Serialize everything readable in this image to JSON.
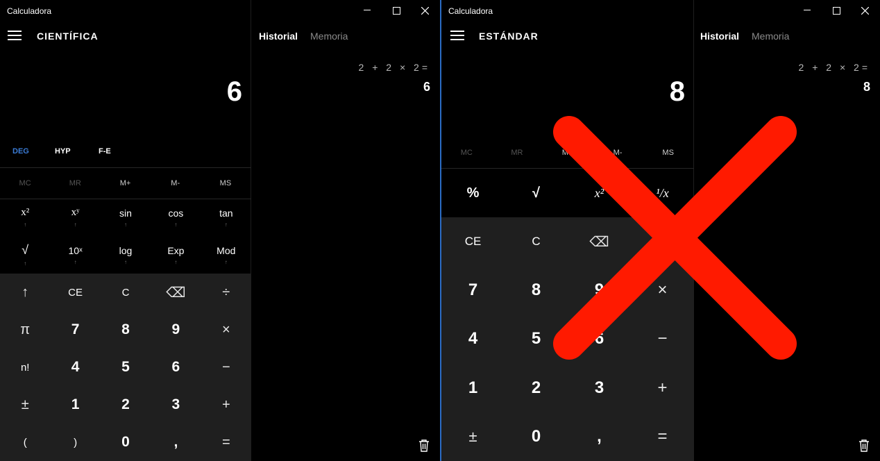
{
  "left": {
    "app_title": "Calculadora",
    "mode": "CIENTÍFICA",
    "display": "6",
    "tabs": [
      "Historial",
      "Memoria"
    ],
    "history_expr": "2 + 2 × 2=",
    "history_result": "6",
    "angle_modes": {
      "deg": "DEG",
      "hyp": "HYP",
      "fe": "F-E"
    },
    "memory": [
      "MC",
      "MR",
      "M+",
      "M-",
      "MS"
    ],
    "functions": [
      {
        "label": "x²"
      },
      {
        "label": "xʸ"
      },
      {
        "label": "sin"
      },
      {
        "label": "cos"
      },
      {
        "label": "tan"
      },
      {
        "label": "√"
      },
      {
        "label": "10ˣ"
      },
      {
        "label": "log"
      },
      {
        "label": "Exp"
      },
      {
        "label": "Mod"
      }
    ],
    "keypad": [
      "↑",
      "CE",
      "C",
      "⌫",
      "÷",
      "π",
      "7",
      "8",
      "9",
      "×",
      "n!",
      "4",
      "5",
      "6",
      "−",
      "±",
      "1",
      "2",
      "3",
      "+",
      "(",
      ")",
      "0",
      ",",
      "="
    ]
  },
  "right": {
    "app_title": "Calculadora",
    "mode": "ESTÁNDAR",
    "display": "8",
    "tabs": [
      "Historial",
      "Memoria"
    ],
    "history_expr": "2 + 2 × 2=",
    "history_result": "8",
    "memory": [
      "MC",
      "MR",
      "M+",
      "M-",
      "MS"
    ],
    "top_row": [
      "%",
      "√",
      "x²",
      "¹/x"
    ],
    "keypad": [
      "CE",
      "C",
      "⌫",
      "÷",
      "7",
      "8",
      "9",
      "×",
      "4",
      "5",
      "6",
      "−",
      "1",
      "2",
      "3",
      "+",
      "±",
      "0",
      ",",
      "="
    ]
  },
  "colors": {
    "accent_blue": "#3a7bd5",
    "cross_red": "#ff1a00",
    "pad_bg": "#1f1f1f"
  },
  "icons": [
    "menu-icon",
    "minimize-icon",
    "maximize-icon",
    "close-icon",
    "trash-icon",
    "backspace-icon"
  ]
}
